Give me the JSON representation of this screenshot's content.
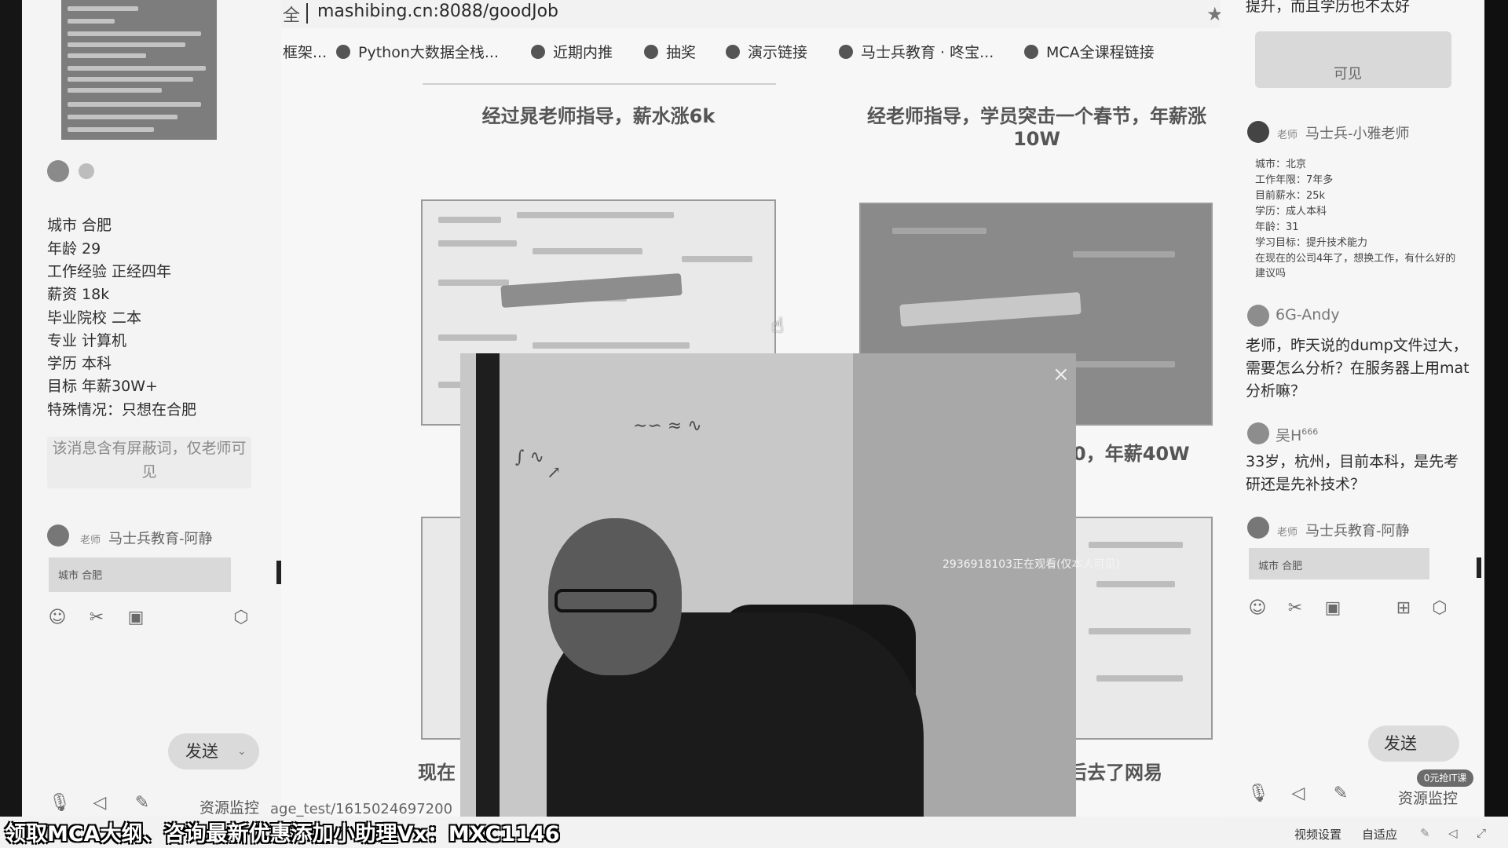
{
  "browser": {
    "url_prefix": "全",
    "url": "mashibing.cn:8088/goodJob",
    "bookmarks": [
      "框架...",
      "Python大数据全栈...",
      "近期内推",
      "抽奖",
      "演示链接",
      "马士兵教育 · 咚宝...",
      "MCA全课程链接"
    ]
  },
  "page": {
    "card1_title": "经过晁老师指导，薪水涨6k",
    "card2_title": "经老师指导，学员突击一个春节，年薪涨10W",
    "card4_title_partial": "0，年薪40W",
    "card5_title_partial": "现在",
    "card6_title_partial": "后去了网易",
    "url_hint": "age_test/1615024697200"
  },
  "video": {
    "viewer_note": "2936918103正在观看(仅本人可见)",
    "close": "×"
  },
  "left_chat": {
    "profile": [
      "城市 合肥",
      "年龄 29",
      "工作经验 正经四年",
      "薪资 18k",
      "毕业院校 二本",
      "专业 计算机",
      "学历 本科",
      "目标 年薪30W+",
      "特殊情况：只想在合肥"
    ],
    "blocked_msg": "该消息含有屏蔽词，仅老师可见",
    "teacher_tag": "老师",
    "teacher_name": "马士兵教育-阿静",
    "quote_preview": "城市 合肥",
    "send": "发送",
    "resource_monitor": "资源监控"
  },
  "right_chat": {
    "top_text": "提升，而且学历也不太好",
    "watermark_text": "可见",
    "msg1_tag": "老师",
    "msg1_name": "马士兵-小雅老师",
    "msg1_lines": [
      "城市：北京",
      "工作年限：7年多",
      "目前薪水：25k",
      "学历：成人本科",
      "年龄：31",
      "学习目标：提升技术能力",
      "在现在的公司4年了，想换工作，有什么好的建议吗"
    ],
    "msg2_name": "6G-Andy",
    "msg2_text": "老师，昨天说的dump文件过大，需要怎么分析？在服务器上用mat分析嘛？",
    "msg3_name": "吴H",
    "msg3_badge": "666",
    "msg3_text": "33岁，杭州，目前本科，是先考研还是先补技术？",
    "msg4_tag": "老师",
    "msg4_name": "马士兵教育-阿静",
    "quote_preview": "城市 合肥",
    "send": "发送",
    "free_badge": "0元抢IT课",
    "resource_monitor": "资源监控"
  },
  "bottom": {
    "promo": "领取MCA大纲、咨询最新优惠添加小助理Vx：MXC1146",
    "video_settings": "视频设置",
    "adaptive": "自适应"
  }
}
